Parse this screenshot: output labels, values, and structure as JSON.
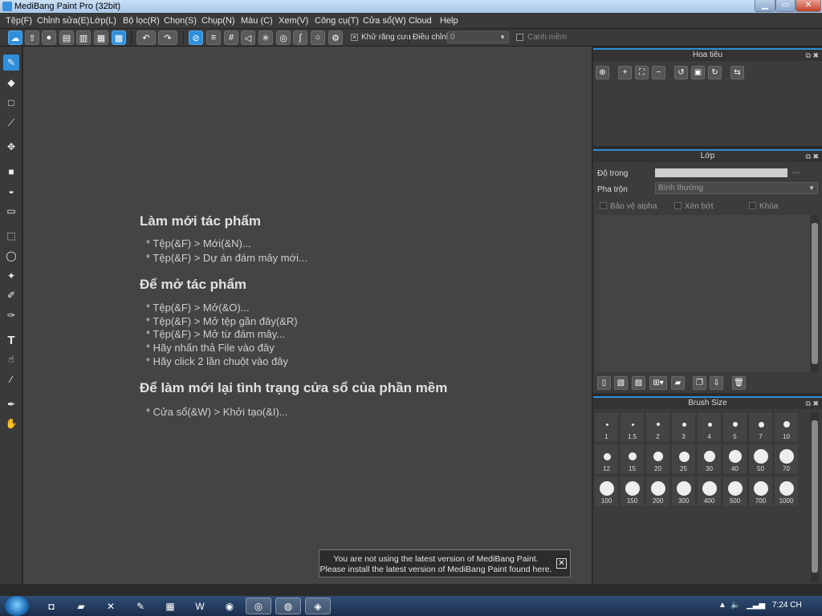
{
  "window": {
    "title": "MediBang Paint Pro (32bit)"
  },
  "menu": [
    "Tệp(F)",
    "Chỉnh sửa(E)",
    "Lớp(L)",
    "Bộ lọc(R)",
    "Chọn(S)",
    "Chụp(N)",
    "Màu (C)",
    "Xem(V)",
    "Công cụ(T)",
    "Cửa sổ(W)",
    "Cloud",
    "Help"
  ],
  "toolbar": {
    "antialias_label": "Khử răng cưa",
    "adjust_label": "Điều chỉnh",
    "adjust_value": "0",
    "soft_edge_label": "Cạnh mềm"
  },
  "welcome": {
    "new_heading": "Làm mới tác phẩm",
    "new_items": [
      "* Tệp(&F) > Mới(&N)...",
      "* Tệp(&F) > Dự án đám mây mới..."
    ],
    "open_heading": "Để mở tác phẩm",
    "open_items": [
      "* Tệp(&F) > Mở(&O)...",
      "* Tệp(&F) > Mở tệp gần đây(&R)",
      "* Tệp(&F) > Mở từ đám mây...",
      "* Hãy nhấn thả File vào đây",
      "* Hãy click 2 lần chuột vào đây"
    ],
    "reset_heading": "Để làm mới lại tình trạng cửa sổ của phần mềm",
    "reset_items": [
      "* Cửa sổ(&W) > Khởi tạo(&I)..."
    ]
  },
  "notice": {
    "line1": "You are not using the latest version of MediBang Paint.",
    "line2": "Please install the latest version of MediBang Paint found here."
  },
  "navigator": {
    "title": "Hoa tiêu"
  },
  "layer": {
    "title": "Lớp",
    "opacity_label": "Độ trong",
    "opacity_value": "---",
    "blend_label": "Pha trộn",
    "blend_value": "Bình thường",
    "protect_alpha": "Bảo vệ alpha",
    "clipping": "Xén bớt",
    "lock": "Khóa"
  },
  "brush_size": {
    "title": "Brush Size",
    "sizes": [
      "1",
      "1.5",
      "2",
      "3",
      "4",
      "5",
      "7",
      "10",
      "12",
      "15",
      "20",
      "25",
      "30",
      "40",
      "50",
      "70",
      "100",
      "150",
      "200",
      "300",
      "400",
      "500",
      "700",
      "1000"
    ]
  },
  "taskbar": {
    "clock": "7:24 CH"
  },
  "colors": {
    "accent": "#2f8fdb",
    "canvas": "#444444",
    "panel": "#3c3c3c"
  }
}
